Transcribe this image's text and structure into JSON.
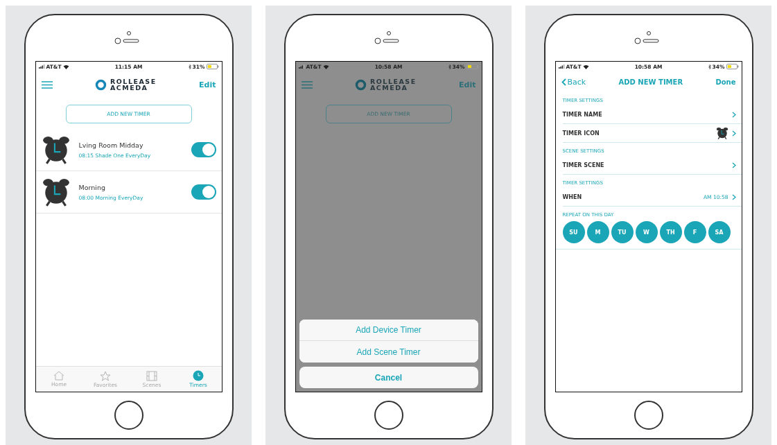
{
  "screens": [
    {
      "kind": "timer_list",
      "status": {
        "carrier": "AT&T",
        "time": "11:15 AM",
        "battery": "31%"
      },
      "header": {
        "logo": [
          "ROLLEASE",
          "ACMEDA"
        ],
        "edit": "Edit"
      },
      "add_button": "ADD NEW TIMER",
      "dimmed": false,
      "timers": [
        {
          "name": "Lving Room Midday",
          "detail": "08:15 Shade One EveryDay",
          "on": true
        },
        {
          "name": "Morning",
          "detail": "08:00 Morning EveryDay",
          "on": true
        }
      ],
      "tabs": [
        {
          "label": "Home",
          "selected": false
        },
        {
          "label": "Favorites",
          "selected": false
        },
        {
          "label": "Scenes",
          "selected": false
        },
        {
          "label": "Timers",
          "selected": true
        }
      ]
    },
    {
      "kind": "timer_list",
      "status": {
        "carrier": "AT&T",
        "time": "10:58 AM",
        "battery": "34%"
      },
      "header": {
        "logo": [
          "ROLLEASE",
          "ACMEDA"
        ],
        "edit": "Edit"
      },
      "add_button": "ADD NEW TIMER",
      "dimmed": true,
      "sheet": {
        "options": [
          "Add Device Timer",
          "Add Scene Timer"
        ],
        "cancel": "Cancel"
      }
    },
    {
      "kind": "timer_form",
      "status": {
        "carrier": "AT&T",
        "time": "10:58 AM",
        "battery": "34%"
      },
      "nav": {
        "back": "Back",
        "title": "ADD NEW TIMER",
        "done": "Done"
      },
      "sections": [
        {
          "label": "TIMER SETTINGS",
          "rows": [
            {
              "kind": "plain",
              "label": "TIMER NAME"
            },
            {
              "kind": "icon",
              "label": "TIMER ICON"
            }
          ]
        },
        {
          "label": "SCENE SETTINGS",
          "rows": [
            {
              "kind": "plain",
              "label": "TIMER SCENE"
            }
          ]
        },
        {
          "label": "TIMER SETTINGS",
          "rows": [
            {
              "kind": "value",
              "label": "WHEN",
              "value": "AM 10:58"
            }
          ]
        }
      ],
      "repeat": {
        "label": "REPEAT ON THIS DAY",
        "days": [
          {
            "label": "SU",
            "selected": true
          },
          {
            "label": "M",
            "selected": true
          },
          {
            "label": "TU",
            "selected": true
          },
          {
            "label": "W",
            "selected": true
          },
          {
            "label": "TH",
            "selected": true
          },
          {
            "label": "F",
            "selected": true
          },
          {
            "label": "SA",
            "selected": true
          }
        ]
      }
    }
  ]
}
